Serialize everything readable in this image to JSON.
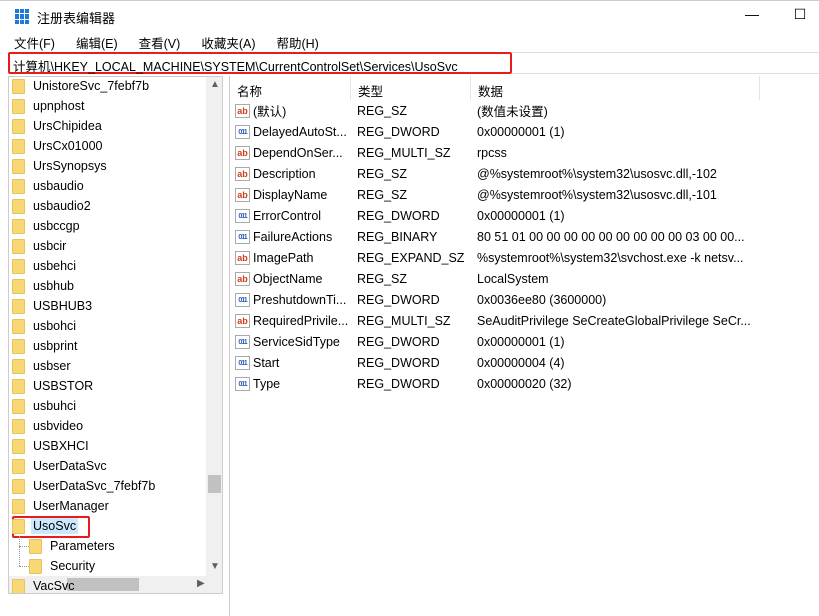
{
  "window": {
    "title": "注册表编辑器",
    "minimize": "—",
    "maximize": "☐"
  },
  "menu": [
    "文件(F)",
    "编辑(E)",
    "查看(V)",
    "收藏夹(A)",
    "帮助(H)"
  ],
  "address": "计算机\\HKEY_LOCAL_MACHINE\\SYSTEM\\CurrentControlSet\\Services\\UsoSvc",
  "tree": {
    "items": [
      "UnistoreSvc_7febf7b",
      "upnphost",
      "UrsChipidea",
      "UrsCx01000",
      "UrsSynopsys",
      "usbaudio",
      "usbaudio2",
      "usbccgp",
      "usbcir",
      "usbehci",
      "usbhub",
      "USBHUB3",
      "usbohci",
      "usbprint",
      "usbser",
      "USBSTOR",
      "usbuhci",
      "usbvideo",
      "USBXHCI",
      "UserDataSvc",
      "UserDataSvc_7febf7b",
      "UserManager",
      "UsoSvc",
      "Parameters",
      "Security",
      "VacSvc"
    ],
    "selected": "UsoSvc"
  },
  "columns": [
    "名称",
    "类型",
    "数据"
  ],
  "values": [
    {
      "icon": "string",
      "name": "(默认)",
      "type": "REG_SZ",
      "data": "(数值未设置)"
    },
    {
      "icon": "binary",
      "name": "DelayedAutoSt...",
      "type": "REG_DWORD",
      "data": "0x00000001 (1)"
    },
    {
      "icon": "string",
      "name": "DependOnSer...",
      "type": "REG_MULTI_SZ",
      "data": "rpcss"
    },
    {
      "icon": "string",
      "name": "Description",
      "type": "REG_SZ",
      "data": "@%systemroot%\\system32\\usosvc.dll,-102"
    },
    {
      "icon": "string",
      "name": "DisplayName",
      "type": "REG_SZ",
      "data": "@%systemroot%\\system32\\usosvc.dll,-101"
    },
    {
      "icon": "binary",
      "name": "ErrorControl",
      "type": "REG_DWORD",
      "data": "0x00000001 (1)"
    },
    {
      "icon": "binary",
      "name": "FailureActions",
      "type": "REG_BINARY",
      "data": "80 51 01 00 00 00 00 00 00 00 00 00 03 00 00..."
    },
    {
      "icon": "string",
      "name": "ImagePath",
      "type": "REG_EXPAND_SZ",
      "data": "%systemroot%\\system32\\svchost.exe -k netsv..."
    },
    {
      "icon": "string",
      "name": "ObjectName",
      "type": "REG_SZ",
      "data": "LocalSystem"
    },
    {
      "icon": "binary",
      "name": "PreshutdownTi...",
      "type": "REG_DWORD",
      "data": "0x0036ee80 (3600000)"
    },
    {
      "icon": "string",
      "name": "RequiredPrivile...",
      "type": "REG_MULTI_SZ",
      "data": "SeAuditPrivilege SeCreateGlobalPrivilege SeCr..."
    },
    {
      "icon": "binary",
      "name": "ServiceSidType",
      "type": "REG_DWORD",
      "data": "0x00000001 (1)"
    },
    {
      "icon": "binary",
      "name": "Start",
      "type": "REG_DWORD",
      "data": "0x00000004 (4)"
    },
    {
      "icon": "binary",
      "name": "Type",
      "type": "REG_DWORD",
      "data": "0x00000020 (32)"
    }
  ],
  "colors": {
    "highlight": "#e81c1c",
    "selection": "#cce8ff",
    "folder": "#f8d775"
  }
}
